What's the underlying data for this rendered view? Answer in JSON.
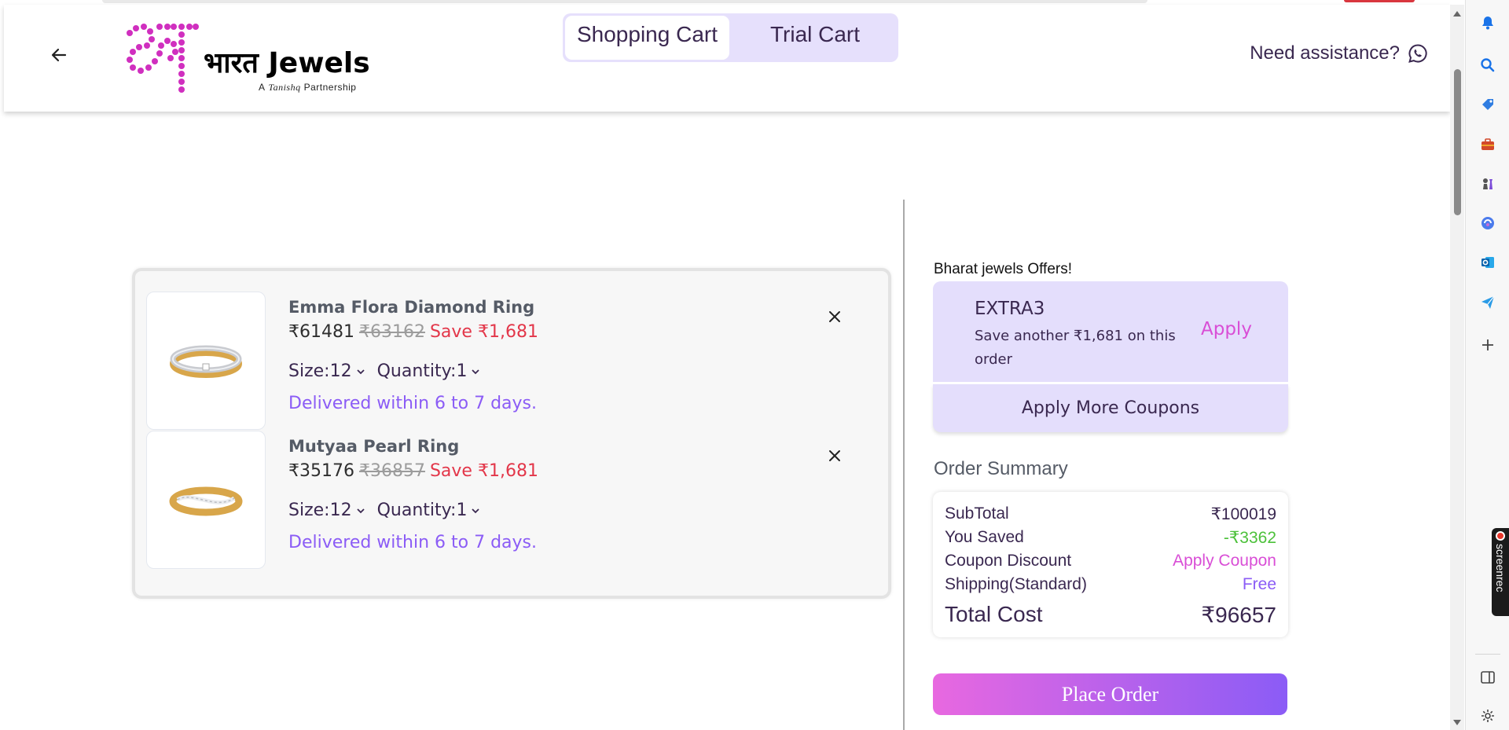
{
  "header": {
    "logo_name": "भारत Jewels",
    "logo_tag_prefix": "A",
    "logo_tag_brand": "Tanishq",
    "logo_tag_suffix": "Partnership",
    "tabs": [
      {
        "label": "Shopping Cart",
        "active": true
      },
      {
        "label": "Trial Cart",
        "active": false
      }
    ],
    "assist_label": "Need assistance?"
  },
  "cart": {
    "items": [
      {
        "name": "Emma Flora Diamond Ring",
        "price": "₹61481",
        "original_price": "₹63162",
        "save": "Save ₹1,681",
        "size": "Size:12",
        "quantity": "Quantity:1",
        "delivery": "Delivered within 6 to 7 days."
      },
      {
        "name": "Mutyaa Pearl Ring",
        "price": "₹35176",
        "original_price": "₹36857",
        "save": "Save ₹1,681",
        "size": "Size:12",
        "quantity": "Quantity:1",
        "delivery": "Delivered within 6 to 7 days."
      }
    ]
  },
  "offers": {
    "title": "Bharat jewels Offers!",
    "coupon": {
      "code": "EXTRA3",
      "description": "Save another ₹1,681 on this order",
      "apply_label": "Apply"
    },
    "more_label": "Apply More Coupons"
  },
  "summary": {
    "title": "Order Summary",
    "rows": [
      {
        "label": "SubTotal",
        "value": "₹100019"
      },
      {
        "label": "You Saved",
        "value": "-₹3362"
      },
      {
        "label": "Coupon Discount",
        "value": "Apply Coupon"
      },
      {
        "label": "Shipping(Standard)",
        "value": "Free"
      }
    ],
    "total_label": "Total Cost",
    "total_value": "₹96657",
    "place_order_label": "Place Order"
  },
  "browser_sidebar": {
    "icons": [
      "bell-icon",
      "search-icon",
      "tag-icon",
      "briefcase-icon",
      "chess-icon",
      "copilot-icon",
      "outlook-icon",
      "send-icon",
      "plus-icon",
      "sidebar-panel-icon",
      "settings-icon"
    ],
    "screenrec_label": "screenrec"
  },
  "colors": {
    "accent_purple": "#8b5cf6",
    "accent_pink": "#d94ed6",
    "toggle_bg": "#e6e0fc",
    "save_red": "#e3374a",
    "saved_green": "#4cc13a"
  }
}
